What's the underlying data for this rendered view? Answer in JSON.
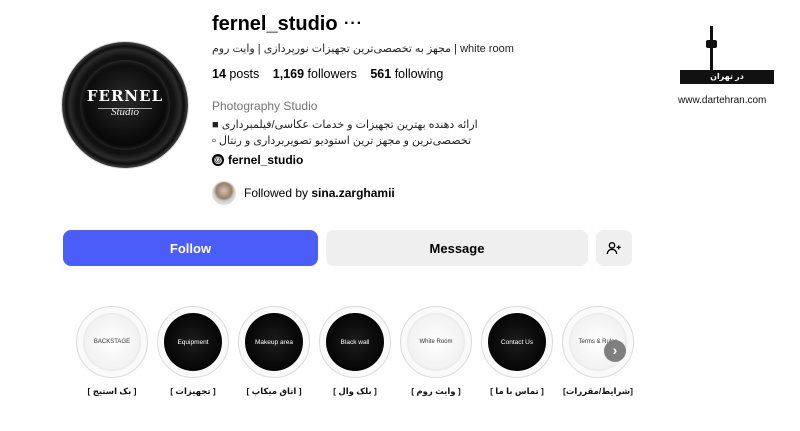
{
  "profile": {
    "username": "fernel_studio",
    "more_label": "···",
    "bio_top": "white room | مجهز به تخصصی‌ترین تجهیزات نورپردازی | وایت روم",
    "stats": {
      "posts_num": "14",
      "posts_label": "posts",
      "followers_num": "1,169",
      "followers_label": "followers",
      "following_num": "561",
      "following_label": "following"
    },
    "category": "Photography Studio",
    "bio_line1": "ارائه دهنده بهترین تجهیزات و خدمات عکاسی/فیلمبرداری ■",
    "bio_line2": "تخصصی‌ترین و مجهز ترین استودیو تصویربرداری و رنتال ▫",
    "threads_handle": "fernel_studio",
    "threads_icon": "threads-icon",
    "followed_by_prefix": "Followed by",
    "followed_by_user": "sina.zarghamii",
    "avatar_logo_top": "FERNEL",
    "avatar_logo_bottom": "Studio"
  },
  "actions": {
    "follow_label": "Follow",
    "message_label": "Message",
    "add_user_icon": "add-user-icon"
  },
  "colors": {
    "follow_bg": "#4a5df9",
    "secondary_bg": "#efefef"
  },
  "brand": {
    "bar_text": "در تهران",
    "url": "www.dartehran.com"
  },
  "highlights": [
    {
      "inner": "BACKSTAGE",
      "caption": "[ بک استیج ]",
      "style": "light"
    },
    {
      "inner": "Equipment",
      "caption": "[ تجهیزات ]",
      "style": "dark"
    },
    {
      "inner": "Makeup area",
      "caption": "[ اتاق میکاپ ]",
      "style": "dark"
    },
    {
      "inner": "Black wall",
      "caption": "[ بلک وال ]",
      "style": "dark"
    },
    {
      "inner": "White Room",
      "caption": "[ وایت روم ]",
      "style": "light"
    },
    {
      "inner": "Contact Us",
      "caption": "[ تماس با ما ]",
      "style": "dark"
    },
    {
      "inner": "Terms & Rules",
      "caption": "[شرایط/مقررات]",
      "style": "light"
    }
  ],
  "next_icon": "chevron-right-icon"
}
